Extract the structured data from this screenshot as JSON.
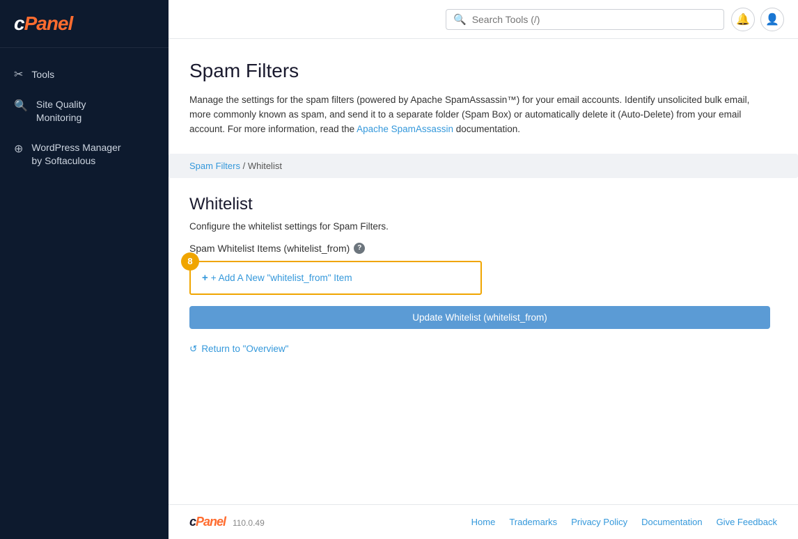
{
  "sidebar": {
    "logo": "cPanel",
    "items": [
      {
        "id": "tools",
        "label": "Tools",
        "icon": "✂"
      },
      {
        "id": "site-quality",
        "label": "Site Quality\nMonitoring",
        "icon": "🔍"
      },
      {
        "id": "wordpress-manager",
        "label": "WordPress Manager\nby Softaculous",
        "icon": "⊕"
      }
    ]
  },
  "header": {
    "search_placeholder": "Search Tools (/)",
    "search_value": ""
  },
  "page": {
    "title": "Spam Filters",
    "description": "Manage the settings for the spam filters (powered by Apache SpamAssassin™) for your email accounts. Identify unsolicited bulk email, more commonly known as spam, and send it to a separate folder (Spam Box) or automatically delete it (Auto-Delete) from your email account. For more information, read the ",
    "description_link_text": "Apache SpamAssassin",
    "description_end": " documentation.",
    "breadcrumb_parent": "Spam Filters",
    "breadcrumb_separator": " / ",
    "breadcrumb_current": "Whitelist",
    "section_title": "Whitelist",
    "section_description": "Configure the whitelist settings for Spam Filters.",
    "whitelist_items_label": "Spam Whitelist Items (whitelist_from)",
    "add_item_label": "+ Add A New \"whitelist_from\" Item",
    "update_button": "Update Whitelist (whitelist_from)",
    "return_link": "Return to \"Overview\"",
    "badge_number": "8"
  },
  "footer": {
    "logo": "cPanel",
    "version": "110.0.49",
    "links": [
      {
        "label": "Home"
      },
      {
        "label": "Trademarks"
      },
      {
        "label": "Privacy Policy"
      },
      {
        "label": "Documentation"
      },
      {
        "label": "Give Feedback"
      }
    ]
  }
}
